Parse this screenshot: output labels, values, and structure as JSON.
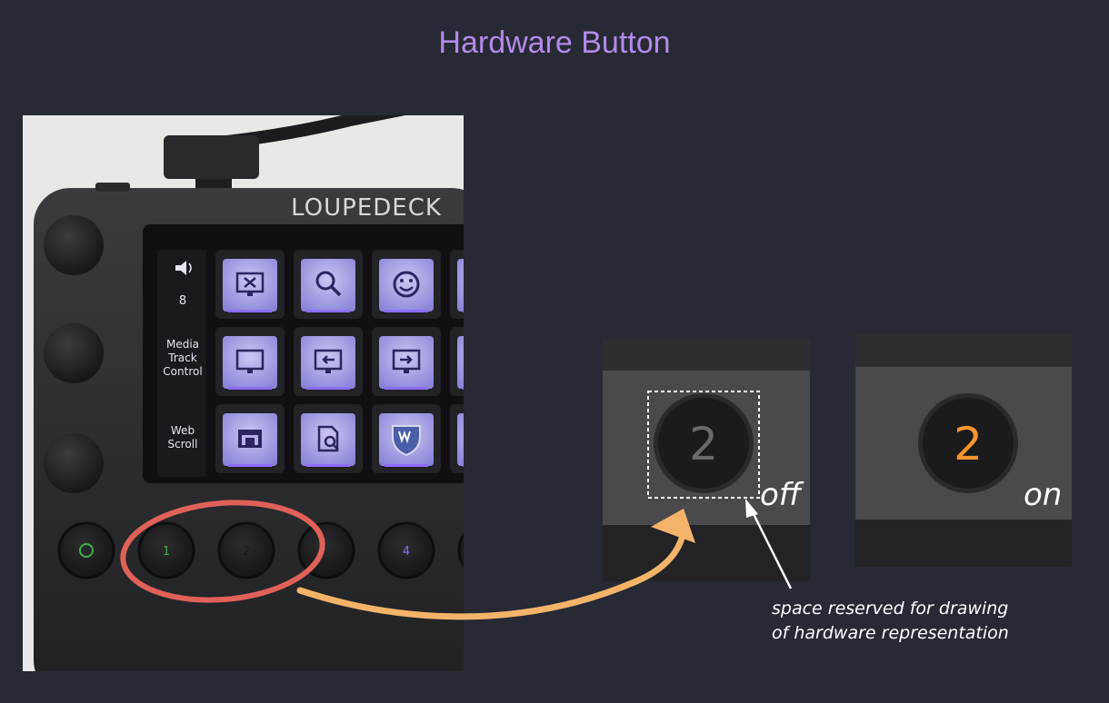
{
  "title": "Hardware Button",
  "device": {
    "logo_text": "LOUPEDECK",
    "lcd_labels": [
      {
        "icon": "speaker-icon",
        "value": "8"
      },
      {
        "text": "Media Track Control"
      },
      {
        "text": "Web Scroll"
      }
    ],
    "keys": [
      [
        "monitor-x-icon",
        "search-icon",
        "smiley-icon"
      ],
      [
        "monitor-icon",
        "monitor-arrow-left-icon",
        "monitor-arrow-right-icon"
      ],
      [
        "folder-window-icon",
        "document-search-icon",
        "shield-badge-icon"
      ]
    ],
    "hardware_buttons": [
      "",
      "1",
      "2",
      "",
      "4"
    ],
    "accent_color": "#8b6cff",
    "highlight_color": "#e0615a"
  },
  "states": {
    "off": {
      "label": "off",
      "button_number": "2",
      "number_color": "#6a6a6a"
    },
    "on": {
      "label": "on",
      "button_number": "2",
      "number_color": "#f5962e"
    }
  },
  "annotation": {
    "line1": "space reserved for drawing",
    "line2": "of hardware representation",
    "arrow_color": "#f3b46a"
  }
}
